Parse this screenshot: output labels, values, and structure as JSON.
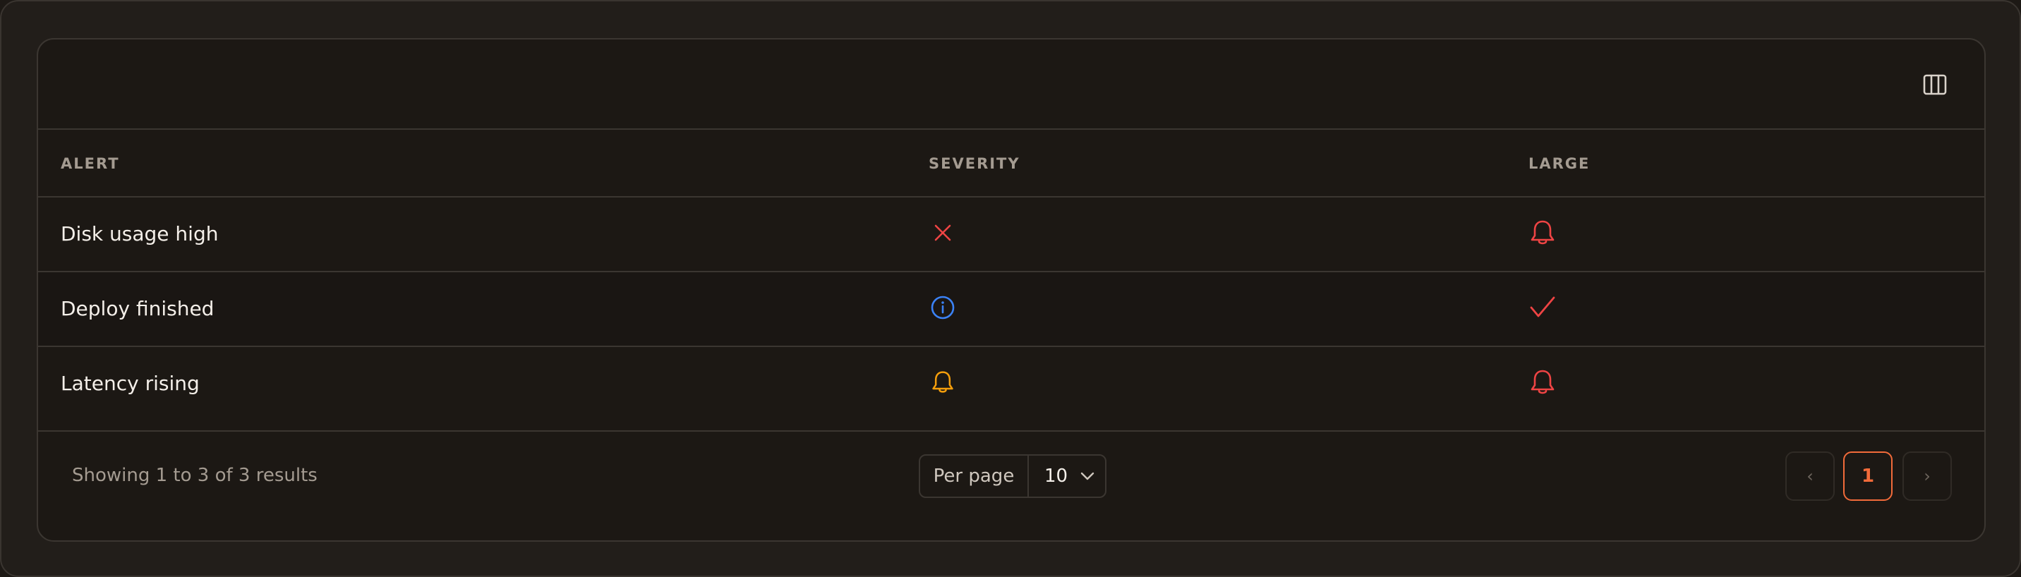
{
  "toolbar": {
    "columns_icon": "columns-icon"
  },
  "table": {
    "headers": [
      "ALERT",
      "SEVERITY",
      "LARGE"
    ],
    "rows": [
      {
        "alert": "Disk usage high",
        "severity_icon": "x-icon",
        "large_icon": "bell-icon"
      },
      {
        "alert": "Deploy finished",
        "severity_icon": "info-icon",
        "large_icon": "check-icon"
      },
      {
        "alert": "Latency rising",
        "severity_icon": "bell-icon",
        "large_icon": "bell-icon"
      }
    ]
  },
  "footer": {
    "showing": "Showing 1 to 3 of 3 results",
    "per_page_label": "Per page",
    "per_page_value": "10",
    "pagination": {
      "prev": "‹",
      "current": "1",
      "next": "›"
    }
  },
  "colors": {
    "danger": "#ef4444",
    "info": "#3b82f6",
    "warning": "#f59e0b",
    "accent": "#f26b3a"
  }
}
